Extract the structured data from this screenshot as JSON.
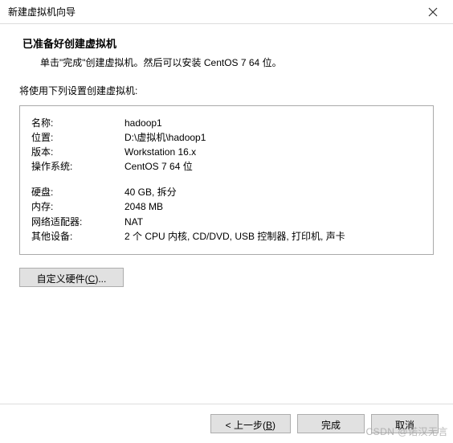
{
  "window": {
    "title": "新建虚拟机向导",
    "close_icon": "×"
  },
  "header": {
    "heading": "已准备好创建虚拟机",
    "subheading": "单击\"完成\"创建虚拟机。然后可以安装 CentOS 7 64 位。"
  },
  "section_label": "将使用下列设置创建虚拟机:",
  "summary": [
    {
      "key": "名称:",
      "val": "hadoop1"
    },
    {
      "key": "位置:",
      "val": "D:\\虚拟机\\hadoop1"
    },
    {
      "key": "版本:",
      "val": "Workstation 16.x"
    },
    {
      "key": "操作系统:",
      "val": "CentOS 7 64 位"
    }
  ],
  "summary2": [
    {
      "key": "硬盘:",
      "val": "40 GB, 拆分"
    },
    {
      "key": "内存:",
      "val": "2048 MB"
    },
    {
      "key": "网络适配器:",
      "val": "NAT"
    },
    {
      "key": "其他设备:",
      "val": "2 个 CPU 内核, CD/DVD, USB 控制器, 打印机, 声卡"
    }
  ],
  "buttons": {
    "customize_pre": "自定义硬件(",
    "customize_u": "C",
    "customize_post": ")...",
    "back_pre": "< 上一步(",
    "back_u": "B",
    "back_post": ")",
    "finish": "完成",
    "cancel": "取消"
  },
  "watermark": "CSDN @诺汉无言"
}
